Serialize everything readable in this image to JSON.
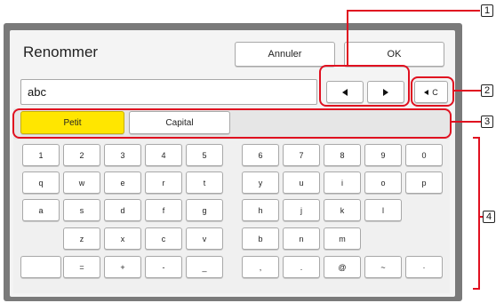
{
  "dialog": {
    "title": "Renommer",
    "cancel_label": "Annuler",
    "ok_label": "OK"
  },
  "name_field": {
    "value": "abc"
  },
  "cursor": {
    "left_icon": "arrow-left-icon",
    "right_icon": "arrow-right-icon"
  },
  "backspace": {
    "label": "C",
    "icon": "backspace-arrow-icon"
  },
  "case": {
    "lower_label": "Petit",
    "upper_label": "Capital",
    "selected": "Petit",
    "selected_color": "#ffe600"
  },
  "keys": {
    "row1": [
      "1",
      "2",
      "3",
      "4",
      "5",
      "6",
      "7",
      "8",
      "9",
      "0"
    ],
    "row2": [
      "q",
      "w",
      "e",
      "r",
      "t",
      "y",
      "u",
      "i",
      "o",
      "p"
    ],
    "row3": [
      "a",
      "s",
      "d",
      "f",
      "g",
      "h",
      "j",
      "k",
      "l"
    ],
    "row4": [
      "z",
      "x",
      "c",
      "v",
      "b",
      "n",
      "m"
    ],
    "row5": [
      "=",
      "+",
      "-",
      "_",
      ",",
      ".",
      "@",
      "~",
      "·"
    ]
  },
  "callouts": [
    "1",
    "2",
    "3",
    "4"
  ],
  "highlight_color": "#e01020"
}
